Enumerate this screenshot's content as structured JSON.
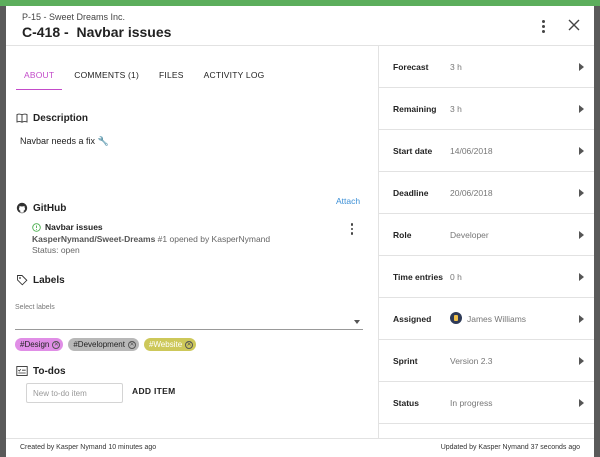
{
  "header": {
    "project": "P-15 - Sweet Dreams Inc.",
    "card_title": "C-418 -  Navbar issues"
  },
  "tabs": [
    {
      "label": "ABOUT",
      "active": true
    },
    {
      "label": "COMMENTS (1)",
      "active": false
    },
    {
      "label": "FILES",
      "active": false
    },
    {
      "label": "ACTIVITY LOG",
      "active": false
    }
  ],
  "description": {
    "title": "Description",
    "text": "Navbar needs a fix 🔧"
  },
  "github": {
    "title": "GitHub",
    "attach_label": "Attach",
    "issue": {
      "title": "Navbar issues",
      "repo": "KasperNymand/Sweet-Dreams",
      "meta": " #1 opened by KasperNymand",
      "status": "Status: open"
    }
  },
  "labels": {
    "title": "Labels",
    "select_label": "Select labels",
    "chips": [
      {
        "label": "#Design",
        "color": "#e08ee6"
      },
      {
        "label": "#Development",
        "color": "#b8b8b8"
      },
      {
        "label": "#Website",
        "color": "#cdc85a"
      }
    ]
  },
  "todos": {
    "title": "To-dos",
    "input_placeholder": "New to-do item",
    "add_label": "ADD ITEM"
  },
  "fields": [
    {
      "label": "Forecast",
      "value": "3 h"
    },
    {
      "label": "Remaining",
      "value": "3 h"
    },
    {
      "label": "Start date",
      "value": "14/06/2018"
    },
    {
      "label": "Deadline",
      "value": "20/06/2018"
    },
    {
      "label": "Role",
      "value": "Developer"
    },
    {
      "label": "Time entries",
      "value": "0 h"
    },
    {
      "label": "Assigned",
      "value": "James Williams",
      "avatar": true
    },
    {
      "label": "Sprint",
      "value": "Version 2.3"
    },
    {
      "label": "Status",
      "value": "In progress"
    }
  ],
  "footer": {
    "created": "Created by Kasper Nymand 10 minutes ago",
    "updated": "Updated by Kasper Nymand 37 seconds ago"
  },
  "colors": {
    "accent": "#c34bc9",
    "link": "#3b8fd6",
    "top_bar": "#5cae5c"
  }
}
